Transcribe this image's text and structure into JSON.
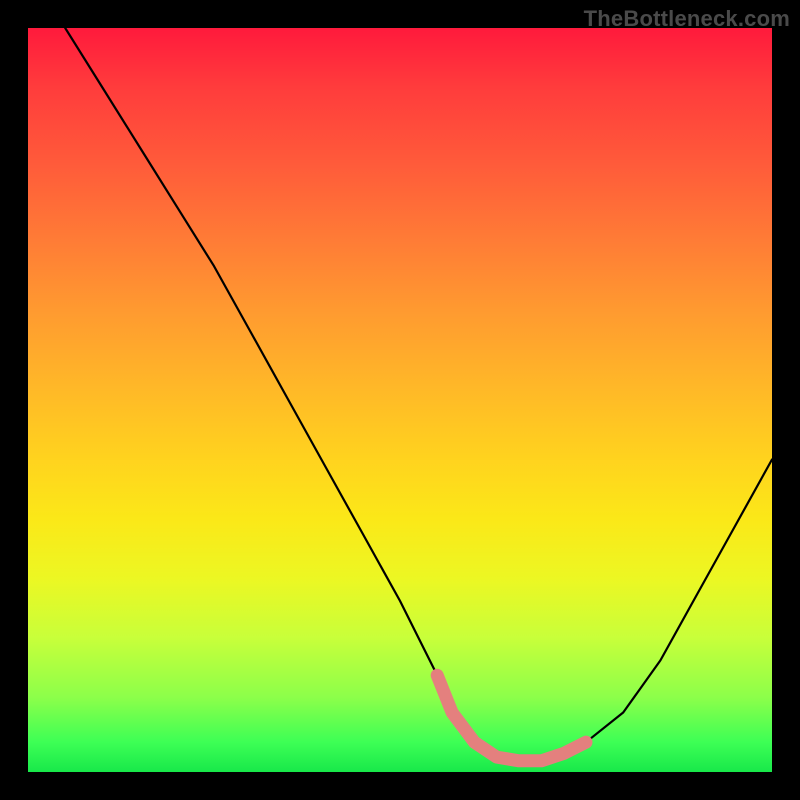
{
  "watermark": "TheBottleneck.com",
  "chart_data": {
    "type": "line",
    "title": "",
    "xlabel": "",
    "ylabel": "",
    "xlim": [
      0,
      100
    ],
    "ylim": [
      0,
      100
    ],
    "series": [
      {
        "name": "bottleneck-curve",
        "x": [
          5,
          10,
          15,
          20,
          25,
          30,
          35,
          40,
          45,
          50,
          55,
          57,
          60,
          63,
          66,
          69,
          72,
          75,
          80,
          85,
          90,
          95,
          100
        ],
        "y": [
          100,
          92,
          84,
          76,
          68,
          59,
          50,
          41,
          32,
          23,
          13,
          8,
          4,
          2,
          1.5,
          1.5,
          2.5,
          4,
          8,
          15,
          24,
          33,
          42
        ]
      }
    ],
    "highlight": {
      "name": "optimal-band",
      "color": "#e4807e",
      "x": [
        55,
        57,
        60,
        63,
        66,
        69,
        72,
        75
      ],
      "y": [
        13,
        8,
        4,
        2,
        1.5,
        1.5,
        2.5,
        4
      ]
    },
    "gradient_stops": [
      {
        "pos": 0,
        "color": "#ff1a3c"
      },
      {
        "pos": 18,
        "color": "#ff5a3a"
      },
      {
        "pos": 38,
        "color": "#ff9a30"
      },
      {
        "pos": 58,
        "color": "#ffd31e"
      },
      {
        "pos": 74,
        "color": "#ecf723"
      },
      {
        "pos": 90,
        "color": "#8cff4a"
      },
      {
        "pos": 100,
        "color": "#18e84a"
      }
    ]
  }
}
